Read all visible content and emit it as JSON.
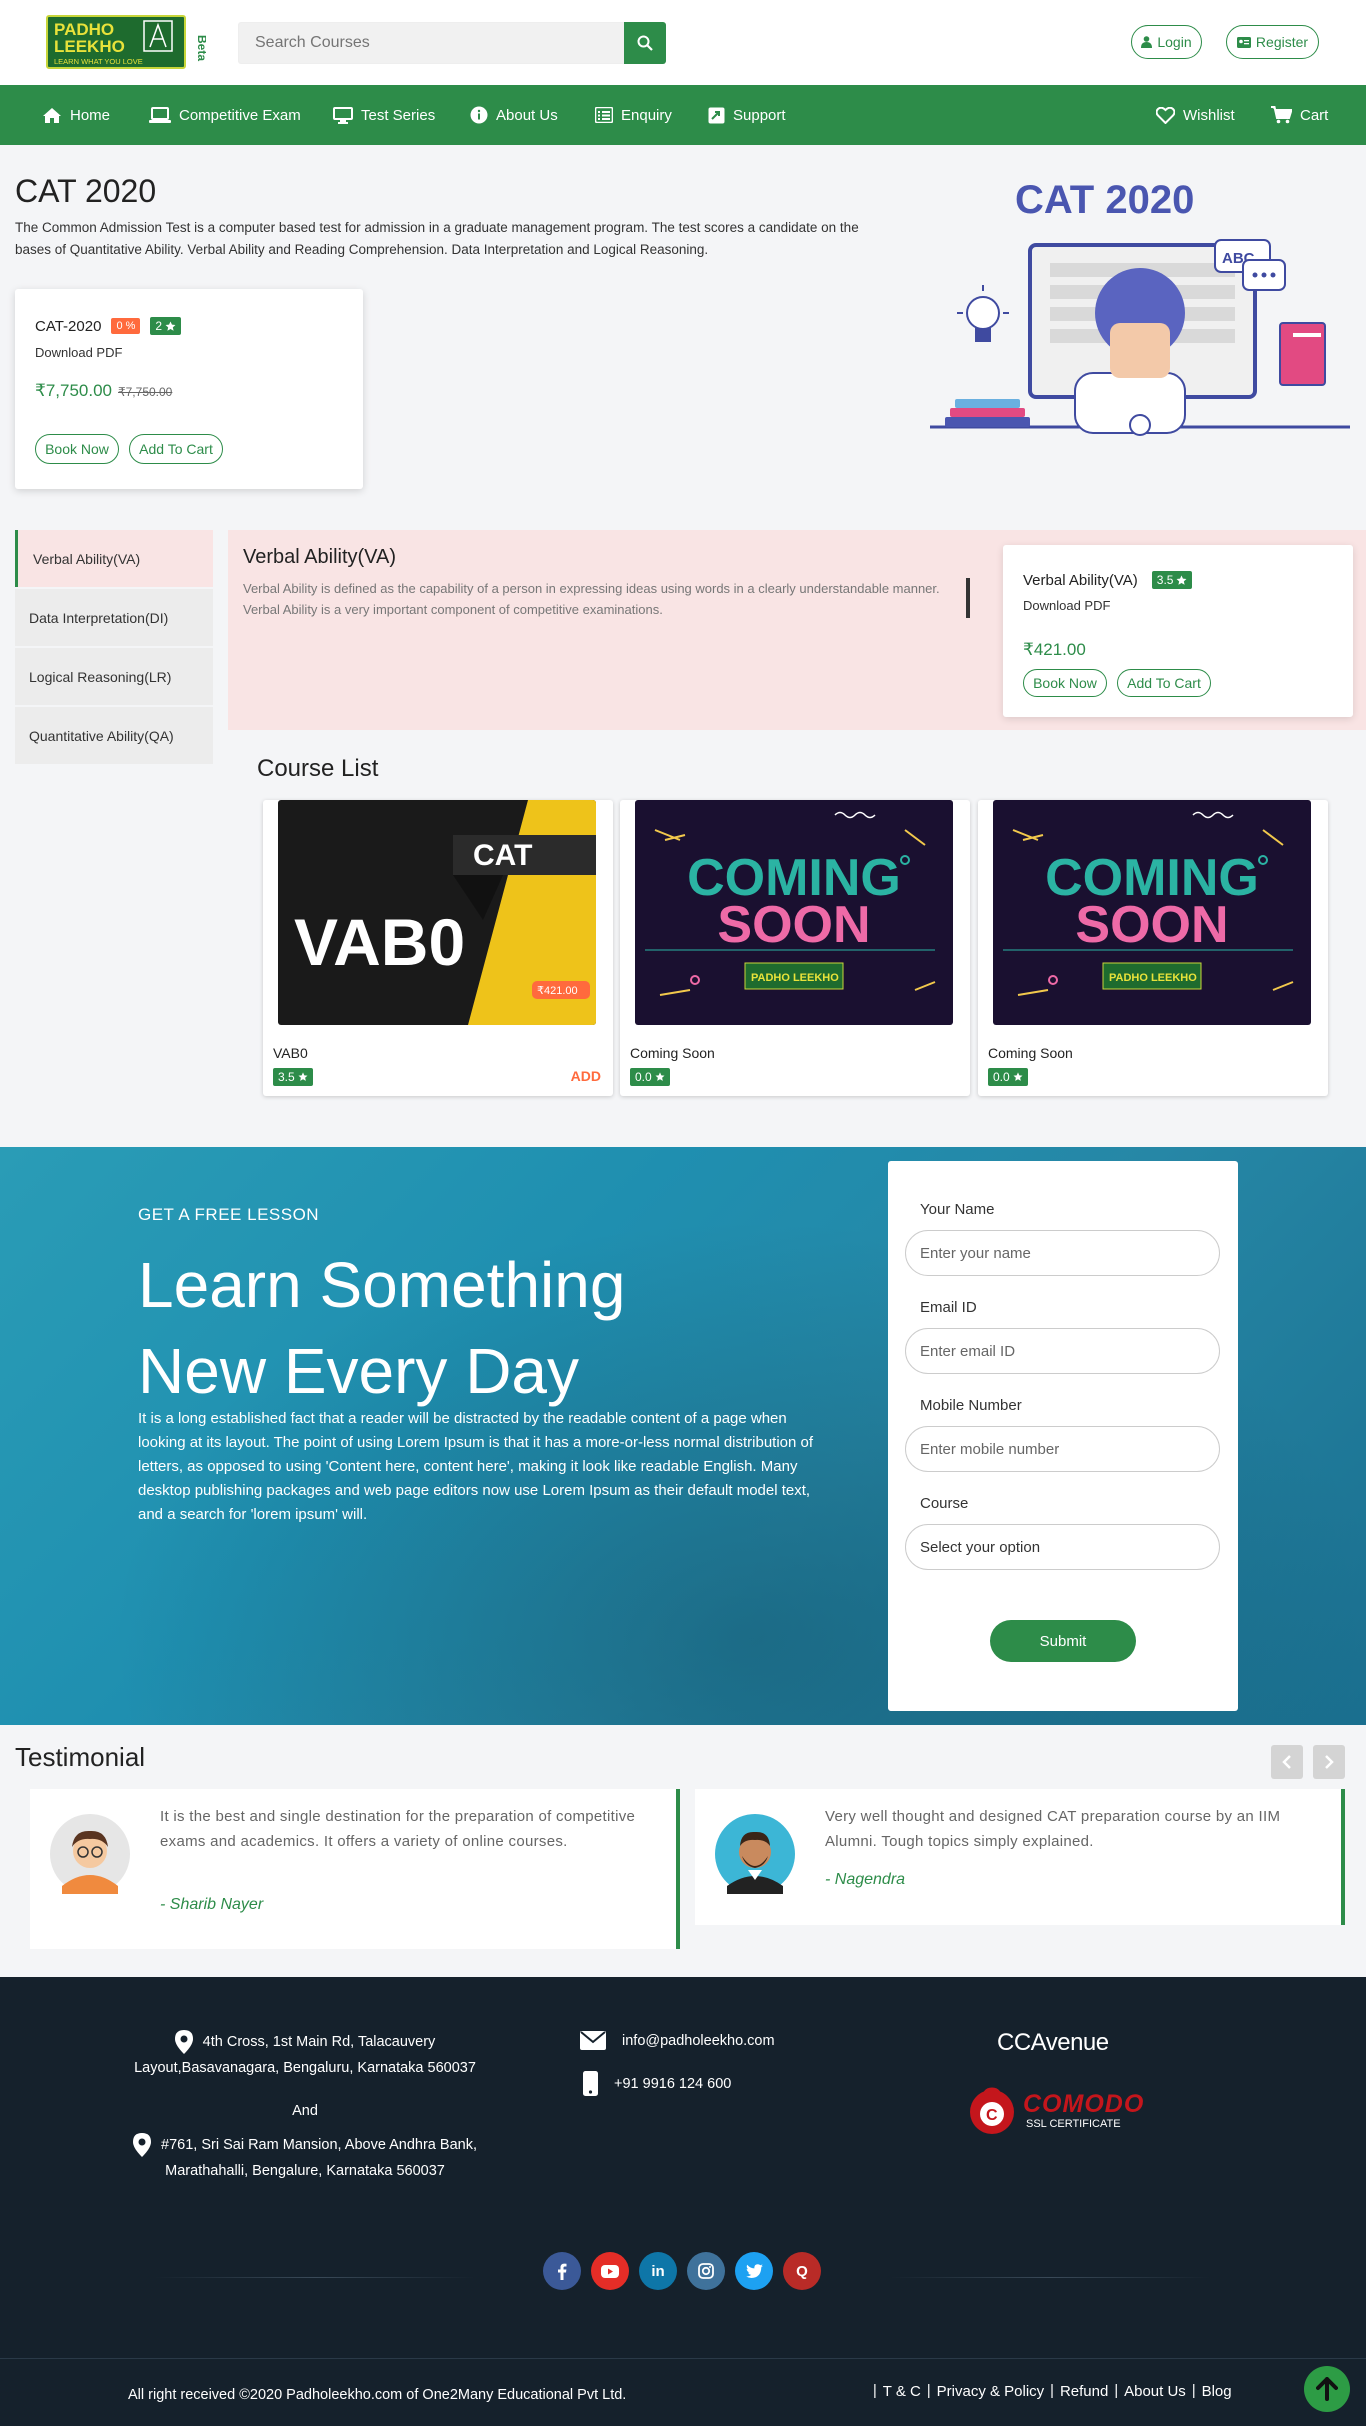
{
  "header": {
    "logo_lines": [
      "PADHO",
      "LEEKHO",
      "LEARN WHAT YOU LOVE",
      "Beta"
    ],
    "search_placeholder": "Search Courses",
    "login_label": "Login",
    "register_label": "Register"
  },
  "nav": {
    "items": [
      {
        "label": "Home",
        "icon": "home-icon"
      },
      {
        "label": "Competitive Exam",
        "icon": "laptop-icon"
      },
      {
        "label": "Test Series",
        "icon": "monitor-icon"
      },
      {
        "label": "About Us",
        "icon": "info-icon"
      },
      {
        "label": "Enquiry",
        "icon": "list-icon"
      },
      {
        "label": "Support",
        "icon": "support-icon"
      }
    ],
    "wishlist_label": "Wishlist",
    "cart_label": "Cart"
  },
  "hero": {
    "title": "CAT 2020",
    "description": "The Common Admission Test is a computer based test for admission in a graduate management program. The test scores a candidate on the bases of Quantitative Ability. Verbal Ability and Reading Comprehension. Data Interpretation and Logical Reasoning.",
    "illustration_title": "CAT 2020",
    "card": {
      "name": "CAT-2020",
      "discount": "0 %",
      "rating": "2",
      "type": "Download PDF",
      "price": "₹7,750.00",
      "old_price": "₹7,750.00",
      "book_label": "Book Now",
      "cart_label": "Add To Cart"
    }
  },
  "subjects": [
    "Verbal Ability(VA)",
    "Data Interpretation(DI)",
    "Logical Reasoning(LR)",
    "Quantitative Ability(QA)"
  ],
  "subject_panel": {
    "title": "Verbal Ability(VA)",
    "description": "Verbal Ability is defined as the capability of a person in expressing ideas using words in a clearly understandable manner. Verbal Ability is a very important component of competitive examinations.",
    "card": {
      "name": "Verbal Ability(VA)",
      "rating": "3.5",
      "type": "Download PDF",
      "price": "₹421.00",
      "book_label": "Book Now",
      "cart_label": "Add To Cart"
    }
  },
  "course_list": {
    "title": "Course List",
    "courses": [
      {
        "name": "VAB0",
        "rating": "3.5",
        "add_label": "ADD",
        "image_text_big": "VAB0",
        "image_text_tag": "CAT",
        "image_price": "₹421.00"
      },
      {
        "name": "Coming Soon",
        "rating": "0.0",
        "image_line1": "COMING",
        "image_line2": "SOON"
      },
      {
        "name": "Coming Soon",
        "rating": "0.0",
        "image_line1": "COMING",
        "image_line2": "SOON"
      }
    ]
  },
  "lesson": {
    "kicker": "GET A FREE LESSON",
    "headline_1": "Learn Something",
    "headline_2": "New Every Day",
    "body": "It is a long established fact that a reader will be distracted by the readable content of a page when looking at its layout. The point of using Lorem Ipsum is that it has a more-or-less normal distribution of letters, as opposed to using 'Content here, content here', making it look like readable English. Many desktop publishing packages and web page editors now use Lorem Ipsum as their default model text, and a search for 'lorem ipsum' will.",
    "form": {
      "name_label": "Your Name",
      "name_placeholder": "Enter your name",
      "email_label": "Email ID",
      "email_placeholder": "Enter email ID",
      "mobile_label": "Mobile Number",
      "mobile_placeholder": "Enter mobile number",
      "course_label": "Course",
      "course_selected": "Select your option",
      "submit_label": "Submit"
    }
  },
  "testimonial": {
    "title": "Testimonial",
    "items": [
      {
        "text": "It is the best and single destination for the preparation of competitive exams and academics. It offers a variety of online courses.",
        "author": "- Sharib Nayer"
      },
      {
        "text": "Very well thought and designed CAT preparation course by an IIM Alumni. Tough topics simply explained.",
        "author": "- Nagendra"
      }
    ]
  },
  "footer": {
    "address_1": "4th Cross, 1st Main Rd, Talacauvery Layout,Basavanagara, Bengaluru, Karnataka 560037",
    "and_label": "And",
    "address_2": "#761, Sri Sai Ram Mansion, Above Andhra Bank, Marathahalli, Bengalure, Karnataka 560037",
    "email": "info@padholeekho.com",
    "phone": "+91 9916 124 600",
    "ccavenue": "CCAvenue",
    "comodo": "COMODO",
    "comodo_sub": "SSL CERTIFICATE",
    "copyright": "All right received ©2020 Padholeekho.com of One2Many Educational Pvt Ltd.",
    "links": [
      "T & C",
      "Privacy & Policy",
      "Refund",
      "About Us",
      "Blog"
    ],
    "social": [
      {
        "icon": "facebook-icon",
        "color": "#3b5998"
      },
      {
        "icon": "youtube-icon",
        "color": "#e52d27"
      },
      {
        "icon": "linkedin-icon",
        "color": "#0e76a8"
      },
      {
        "icon": "instagram-icon",
        "color": "#3f729b"
      },
      {
        "icon": "twitter-icon",
        "color": "#1da1f2"
      },
      {
        "icon": "quora-icon",
        "color": "#b92b27"
      }
    ]
  },
  "colors": {
    "brand_green": "#2d8c49",
    "discount_orange": "#ff6a3d",
    "footer_bg": "#15212c"
  }
}
